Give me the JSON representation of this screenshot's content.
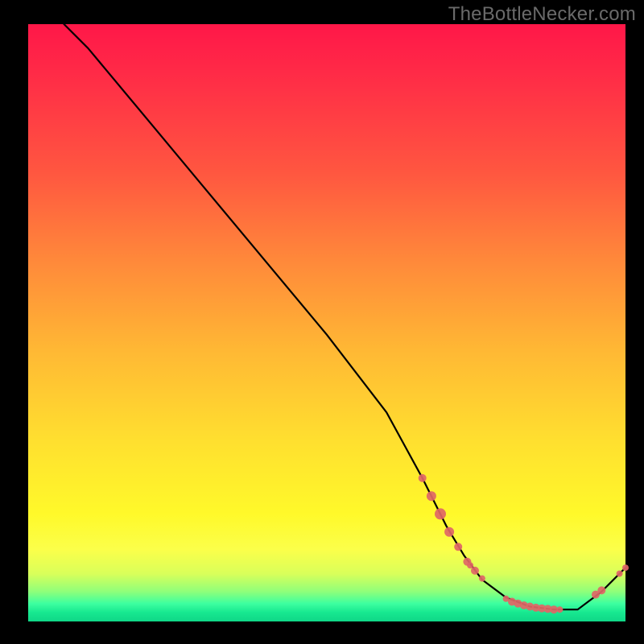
{
  "watermark": "TheBottleNecker.com",
  "chart_data": {
    "type": "line",
    "title": "",
    "xlabel": "",
    "ylabel": "",
    "xlim": [
      0,
      100
    ],
    "ylim": [
      0,
      100
    ],
    "series": [
      {
        "name": "curve",
        "x": [
          6,
          10,
          20,
          30,
          40,
          50,
          60,
          66,
          70,
          73,
          76,
          80,
          84,
          88,
          92,
          96,
          100
        ],
        "y": [
          100,
          96,
          84,
          72,
          60,
          48,
          35,
          24,
          16,
          11,
          7,
          4,
          2.5,
          2,
          2,
          5,
          9
        ]
      }
    ],
    "markers": [
      {
        "x": 66,
        "y": 24,
        "r": 5
      },
      {
        "x": 67.5,
        "y": 21,
        "r": 6
      },
      {
        "x": 69,
        "y": 18,
        "r": 7
      },
      {
        "x": 70.5,
        "y": 15,
        "r": 6
      },
      {
        "x": 72,
        "y": 12.5,
        "r": 5
      },
      {
        "x": 73.5,
        "y": 10,
        "r": 5
      },
      {
        "x": 74,
        "y": 9.4,
        "r": 4
      },
      {
        "x": 74.8,
        "y": 8.5,
        "r": 5
      },
      {
        "x": 76,
        "y": 7.2,
        "r": 4
      },
      {
        "x": 80,
        "y": 3.8,
        "r": 4
      },
      {
        "x": 81,
        "y": 3.3,
        "r": 5
      },
      {
        "x": 82,
        "y": 3.0,
        "r": 5
      },
      {
        "x": 83,
        "y": 2.7,
        "r": 5
      },
      {
        "x": 84,
        "y": 2.5,
        "r": 5
      },
      {
        "x": 85,
        "y": 2.3,
        "r": 5
      },
      {
        "x": 86,
        "y": 2.2,
        "r": 5
      },
      {
        "x": 87,
        "y": 2.1,
        "r": 5
      },
      {
        "x": 88,
        "y": 2.0,
        "r": 5
      },
      {
        "x": 89,
        "y": 2.0,
        "r": 4
      },
      {
        "x": 95,
        "y": 4.5,
        "r": 5
      },
      {
        "x": 96,
        "y": 5.2,
        "r": 5
      },
      {
        "x": 99,
        "y": 8.0,
        "r": 4
      },
      {
        "x": 100,
        "y": 9.0,
        "r": 4
      }
    ],
    "gradient_stops": [
      {
        "pct": 0,
        "color": "#ff1748"
      },
      {
        "pct": 25,
        "color": "#ff5740"
      },
      {
        "pct": 55,
        "color": "#ffb934"
      },
      {
        "pct": 82,
        "color": "#fff92a"
      },
      {
        "pct": 95,
        "color": "#8fff7a"
      },
      {
        "pct": 100,
        "color": "#0fd787"
      }
    ]
  }
}
